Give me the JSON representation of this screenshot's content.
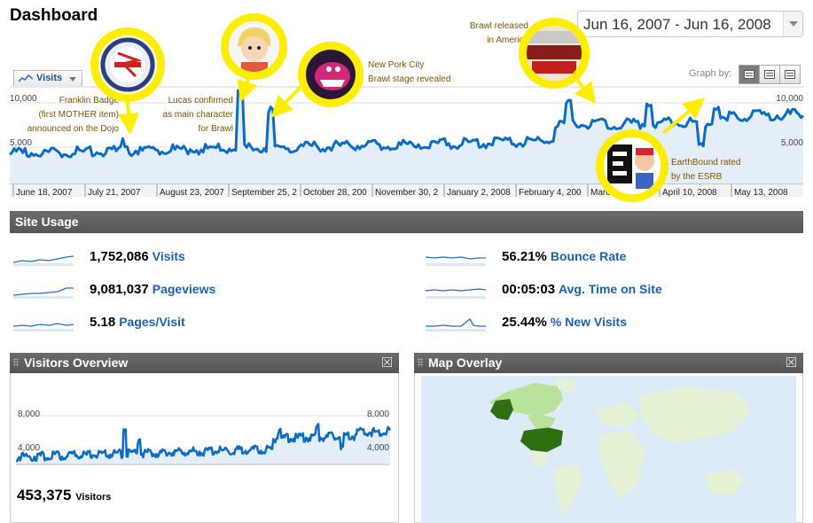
{
  "page": {
    "title": "Dashboard"
  },
  "date_range": {
    "label": "Jun 16, 2007 - Jun 16, 2008"
  },
  "metric_selector": {
    "label": "Visits"
  },
  "graph_by": {
    "label": "Graph by:",
    "options": [
      "day",
      "week",
      "month"
    ],
    "selected": "day"
  },
  "main_chart": {
    "y_ticks_left": [
      "10,000",
      "5,000"
    ],
    "y_ticks_right": [
      "10,000",
      "5,000"
    ],
    "x_labels": [
      "June 18, 2007",
      "July 21, 2007",
      "August 23, 2007",
      "September 25, 2",
      "October 28, 200",
      "November 30, 2",
      "January 2, 2008",
      "February 4, 200",
      "March",
      "April 10, 2008",
      "May 13, 2008"
    ],
    "line_color": "#0a6cc4",
    "fill_color": "#e4eef8"
  },
  "annotations": {
    "franklin": [
      "Franklin Badge",
      "(first MOTHER item)",
      "announced on the Dojo"
    ],
    "lucas": [
      "Lucas confirmed",
      "as main character",
      "for Brawl"
    ],
    "newpork": [
      "New Pork City",
      "Brawl stage revealed"
    ],
    "brawl": [
      "Brawl released",
      "in America"
    ],
    "earthbound": [
      "EarthBound rated",
      "by the ESRB"
    ],
    "badge_ring_color": "#ffed00"
  },
  "site_usage": {
    "title": "Site Usage",
    "metrics": [
      {
        "value": "1,752,086",
        "label": "Visits"
      },
      {
        "value": "9,081,037",
        "label": "Pageviews"
      },
      {
        "value": "5.18",
        "label": "Pages/Visit"
      },
      {
        "value": "56.21%",
        "label": "Bounce Rate"
      },
      {
        "value": "00:05:03",
        "label": "Avg. Time on Site"
      },
      {
        "value": "25.44%",
        "label": "% New Visits"
      }
    ]
  },
  "visitors_overview": {
    "title": "Visitors Overview",
    "y_ticks_left": [
      "8,000",
      "4,000"
    ],
    "y_ticks_right": [
      "8,000",
      "4,000"
    ],
    "count": "453,375",
    "count_label": "Visitors"
  },
  "map_overlay": {
    "title": "Map Overlay",
    "ocean_color": "#dcebf7",
    "land_color": "#e6f2d4",
    "high_color": "#2e6f12",
    "mid_color": "#b9e29b"
  }
}
